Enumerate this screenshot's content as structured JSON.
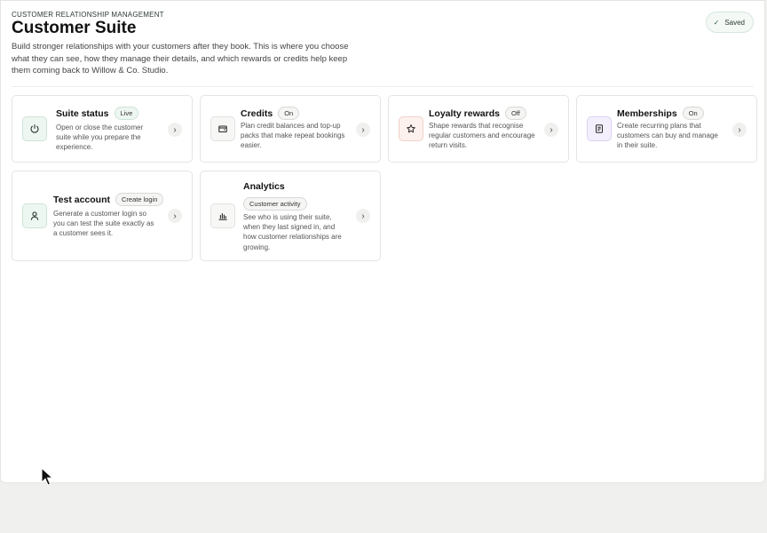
{
  "header": {
    "eyebrow": "CUSTOMER RELATIONSHIP MANAGEMENT",
    "title": "Customer Suite",
    "description": "Build stronger relationships with your customers after they book. This is where you choose what they can see, how they manage their details, and which rewards or credits help keep them coming back to Willow & Co. Studio.",
    "saved_label": "Saved",
    "saved_icon": "check-icon"
  },
  "cards": [
    {
      "title": "Suite status",
      "badge": "Live",
      "icon": "power-icon",
      "description": "Open or close the customer suite while you prepare the experience."
    },
    {
      "title": "Credits",
      "badge": "On",
      "icon": "wallet-icon",
      "description": "Plan credit balances and top-up packs that make repeat bookings easier."
    },
    {
      "title": "Loyalty rewards",
      "badge": "Off",
      "icon": "star-icon",
      "description": "Shape rewards that recognise regular customers and encourage return visits."
    },
    {
      "title": "Memberships",
      "badge": "On",
      "icon": "document-icon",
      "description": "Create recurring plans that customers can buy and manage in their suite."
    },
    {
      "title": "Test account",
      "badge": "Create login",
      "icon": "user-icon",
      "description": "Generate a customer login so you can test the suite exactly as a customer sees it."
    },
    {
      "title": "Analytics",
      "badge": "Customer activity",
      "icon": "bar-chart-icon",
      "description": "See who is using their suite, when they last signed in, and how customer relationships are growing."
    }
  ],
  "colors": {
    "suite_status_icon_bg": "#eef6f1",
    "credits_icon_bg": "#f7f7f5",
    "loyalty_icon_bg": "#fdf1ee",
    "memberships_icon_bg": "#f3effc",
    "test_account_icon_bg": "#edf7f1",
    "analytics_icon_bg": "#f7f7f5"
  }
}
